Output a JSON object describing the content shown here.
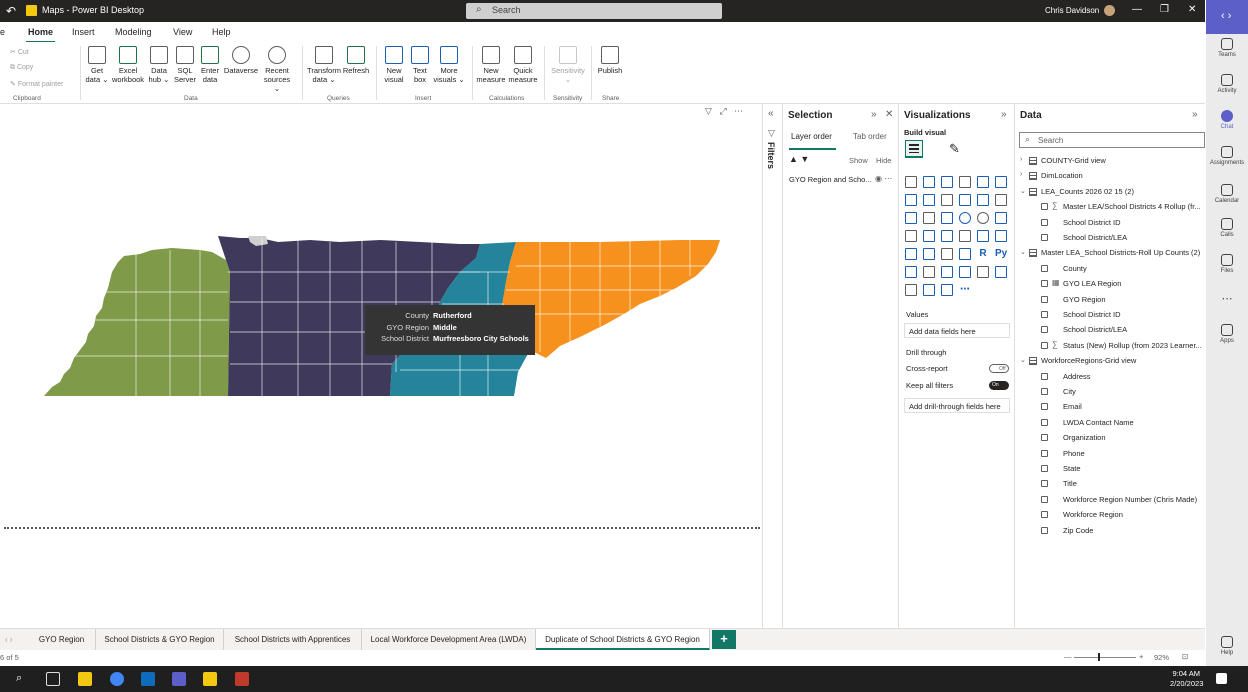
{
  "window": {
    "title": "Maps - Power BI Desktop",
    "search_placeholder": "Search",
    "user": "Chris Davidson"
  },
  "ribbon_tabs": [
    "e",
    "Home",
    "Insert",
    "Modeling",
    "View",
    "Help"
  ],
  "clipboard": {
    "cut": "Cut",
    "copy": "Copy",
    "format_painter": "Format painter",
    "group": "Clipboard"
  },
  "data_group": {
    "items": [
      [
        "Get",
        "data ⌄"
      ],
      [
        "Excel",
        "workbook"
      ],
      [
        "Data",
        "hub ⌄"
      ],
      [
        "SQL",
        "Server"
      ],
      [
        "Enter",
        "data"
      ],
      [
        "Dataverse",
        ""
      ],
      [
        "Recent",
        "sources ⌄"
      ]
    ],
    "label": "Data"
  },
  "queries": {
    "items": [
      [
        "Transform",
        "data ⌄"
      ],
      [
        "Refresh",
        ""
      ]
    ],
    "label": "Queries"
  },
  "insert": {
    "items": [
      [
        "New",
        "visual"
      ],
      [
        "Text",
        "box"
      ],
      [
        "More",
        "visuals ⌄"
      ]
    ],
    "label": "Insert"
  },
  "calculations": {
    "items": [
      [
        "New",
        "measure"
      ],
      [
        "Quick",
        "measure"
      ]
    ],
    "label": "Calculations"
  },
  "sensitivity": {
    "item": [
      "Sensitivity",
      "⌄"
    ],
    "label": "Sensitivity"
  },
  "share": {
    "item": "Publish",
    "label": "Share"
  },
  "map": {
    "region_colors": {
      "west": "#7f9a48",
      "middle": "#3f3a5c",
      "teal": "#24849b",
      "east": "#f7911e"
    }
  },
  "tooltip": {
    "rows": [
      {
        "key": "County",
        "value": "Rutherford"
      },
      {
        "key": "GYO Region",
        "value": "Middle"
      },
      {
        "key": "School District",
        "value": "Murfreesboro City Schools"
      }
    ]
  },
  "filters_label": "Filters",
  "selection": {
    "title": "Selection",
    "tab_layer": "Layer order",
    "tab_tab": "Tab order",
    "show": "Show",
    "hide": "Hide",
    "layer_item": "GYO Region and Scho..."
  },
  "visualizations": {
    "title": "Visualizations",
    "build": "Build visual",
    "values": "Values",
    "values_well": "Add data fields here",
    "drill_through": "Drill through",
    "cross_report": "Cross-report",
    "cross_state": "Off",
    "keep_filters": "Keep all filters",
    "keep_state": "On",
    "drill_well": "Add drill-through fields here"
  },
  "data_pane": {
    "title": "Data",
    "search_placeholder": "Search",
    "tree": [
      {
        "type": "table",
        "label": "COUNTY-Grid view",
        "exp": "›"
      },
      {
        "type": "table",
        "label": "DimLocation",
        "exp": "›"
      },
      {
        "type": "table",
        "label": "LEA_Counts 2026 02 15 (2)",
        "exp": "⌄"
      },
      {
        "type": "field",
        "label": "Master LEA/School Districts 4 Rollup (fr...",
        "sym": "∑"
      },
      {
        "type": "field",
        "label": "School District ID",
        "sym": ""
      },
      {
        "type": "field",
        "label": "School District/LEA",
        "sym": ""
      },
      {
        "type": "table",
        "label": "Master LEA_School Districts-Roll Up Counts (2)",
        "exp": "⌄"
      },
      {
        "type": "field",
        "label": "County",
        "sym": ""
      },
      {
        "type": "field",
        "label": "GYO LEA Region",
        "sym": "▦"
      },
      {
        "type": "field",
        "label": "GYO Region",
        "sym": ""
      },
      {
        "type": "field",
        "label": "School District ID",
        "sym": ""
      },
      {
        "type": "field",
        "label": "School District/LEA",
        "sym": ""
      },
      {
        "type": "field",
        "label": "Status (New) Rollup (from 2023 Learner...",
        "sym": "∑"
      },
      {
        "type": "table",
        "label": "WorkforceRegions-Grid view",
        "exp": "⌄"
      },
      {
        "type": "field",
        "label": "Address",
        "sym": ""
      },
      {
        "type": "field",
        "label": "City",
        "sym": ""
      },
      {
        "type": "field",
        "label": "Email",
        "sym": ""
      },
      {
        "type": "field",
        "label": "LWDA Contact Name",
        "sym": ""
      },
      {
        "type": "field",
        "label": "Organization",
        "sym": ""
      },
      {
        "type": "field",
        "label": "Phone",
        "sym": ""
      },
      {
        "type": "field",
        "label": "State",
        "sym": ""
      },
      {
        "type": "field",
        "label": "Title",
        "sym": ""
      },
      {
        "type": "field",
        "label": "Workforce Region Number (Chris Made)",
        "sym": ""
      },
      {
        "type": "field",
        "label": "Workforce Region",
        "sym": ""
      },
      {
        "type": "field",
        "label": "Zip Code",
        "sym": ""
      }
    ]
  },
  "rail": [
    {
      "label": "Teams",
      "icon": "teams-icon"
    },
    {
      "label": "Activity",
      "icon": "bell-icon"
    },
    {
      "label": "Chat",
      "icon": "chat-icon"
    },
    {
      "label": "Assignments",
      "icon": "assignments-icon"
    },
    {
      "label": "Calendar",
      "icon": "calendar-icon"
    },
    {
      "label": "Calls",
      "icon": "phone-icon"
    },
    {
      "label": "Files",
      "icon": "file-icon"
    },
    {
      "label": "",
      "icon": "more-icon"
    },
    {
      "label": "Apps",
      "icon": "apps-icon"
    },
    {
      "label": "Help",
      "icon": "help-icon"
    }
  ],
  "page_tabs": [
    "GYO Region",
    "School Districts & GYO Region",
    "School Districts with Apprentices",
    "Local Workforce Development Area (LWDA)",
    "Duplicate of School Districts & GYO Region"
  ],
  "page_indicator": "6 of 5",
  "zoom": "92%",
  "clock": {
    "time": "9:04 AM",
    "date": "2/20/2023"
  }
}
